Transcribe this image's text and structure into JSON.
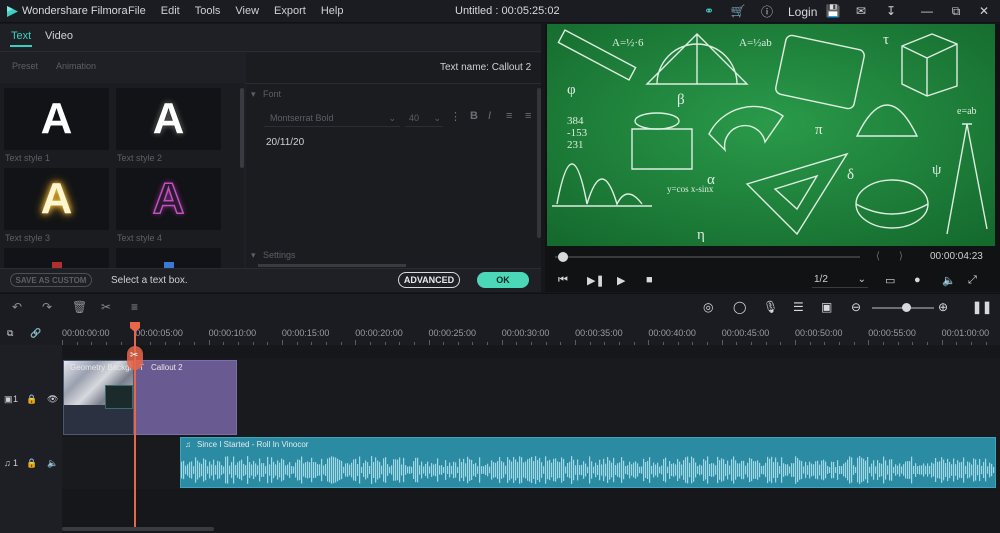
{
  "app": {
    "name": "Wondershare Filmora",
    "title": "Untitled : 00:05:25:02",
    "menu": [
      "File",
      "Edit",
      "Tools",
      "View",
      "Export",
      "Help"
    ],
    "login": "Login"
  },
  "panel": {
    "tabs": [
      "Text",
      "Video"
    ],
    "subtabs": [
      "Preset",
      "Animation"
    ],
    "styles": [
      "Text style 1",
      "Text style 2",
      "Text style 3",
      "Text style 4"
    ],
    "text_name": "Text name: Callout 2",
    "font_section": "Font",
    "font_family": "Montserrat Bold",
    "font_size": "40",
    "text_value": "20/11/20",
    "settings_section": "Settings",
    "save_custom": "SAVE AS CUSTOM",
    "hint": "Select a text box.",
    "advanced": "ADVANCED",
    "ok": "OK"
  },
  "preview": {
    "timecode": "00:00:04:23",
    "ratio": "1/2",
    "progress": 0.02
  },
  "timeline": {
    "ruler": [
      "00:00:00:00",
      "00:00:05:00",
      "00:00:10:00",
      "00:00:15:00",
      "00:00:20:00",
      "00:00:25:00",
      "00:00:30:00",
      "00:00:35:00",
      "00:00:40:00",
      "00:00:45:00",
      "00:00:50:00",
      "00:00:55:00",
      "00:01:00:00"
    ],
    "clips": {
      "video_label": "Geometry Backgr...",
      "callout_label": "Callout 2",
      "audio_label": "Since I Started - Roll In Vinocor"
    },
    "tracks": {
      "video": "1",
      "audio": "1"
    }
  },
  "colors": {
    "accent": "#34d1c2",
    "ok": "#4ad8b8",
    "playhead": "#e8664a",
    "callout": "#6a5a92",
    "audio": "#2b8ba3",
    "board": "#1f7a3a"
  }
}
